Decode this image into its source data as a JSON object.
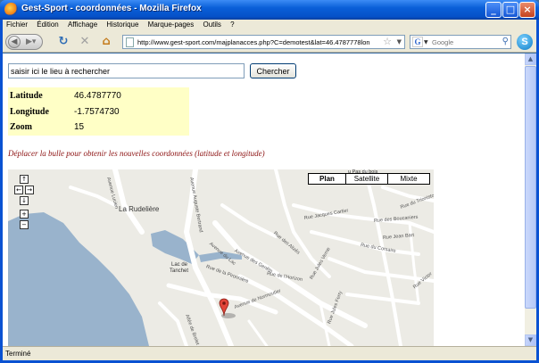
{
  "window": {
    "title": "Gest-Sport - coordonnées - Mozilla Firefox",
    "minimize": "_",
    "maximize": "□",
    "close": "×"
  },
  "menu": [
    "Fichier",
    "Édition",
    "Affichage",
    "Historique",
    "Marque-pages",
    "Outils",
    "?"
  ],
  "nav": {
    "url": "http://www.gest-sport.com/majplanacces.php?C=demotest&lat=46.4787778lon",
    "search_placeholder": "Google",
    "search_logo": "G",
    "skype": "S"
  },
  "page": {
    "search_input_value": "saisir ici le lieu à rechercher",
    "search_button": "Chercher",
    "coords": [
      {
        "label": "Latitude",
        "value": "46.4787770"
      },
      {
        "label": "Longitude",
        "value": "-1.7574730"
      },
      {
        "label": "Zoom",
        "value": "15"
      }
    ],
    "hint": "Déplacer la bulle pour obtenir les nouvelles coordonnées (latitude et longitude)"
  },
  "map": {
    "types": [
      "Plan",
      "Satellite",
      "Mixte"
    ],
    "selected_type": "Plan",
    "places": {
      "rudeliere": "La Rudelière",
      "lac": "Lac de",
      "lac2": "Tanchet",
      "pas_du_bois": "u Pas du bois"
    },
    "streets": [
      "Avenue du Lac",
      "Avenue des Genêts",
      "Rue de la Pironnière",
      "Rue Jacques Cartier",
      "Rue des Boucaniers",
      "Rue Jean Bart",
      "Rue du Trioniston",
      "Rue du Corsaire",
      "Rue de l'Horizon",
      "Avenue de Normoutier",
      "Rue Jules Verne",
      "Rue des Alizés",
      "Allée de Brelet",
      "Rue Jules Ferry",
      "Rue Victor",
      "Avenue Auguste Bertrand",
      "Avenue Lucien"
    ],
    "controls": {
      "up": "↑",
      "left": "←",
      "right": "→",
      "down": "↓",
      "zoom_in": "+",
      "zoom_out": "−"
    }
  },
  "status": "Terminé",
  "colors": {
    "title_bar": "#0a5fd8",
    "coords_bg": "#ffffc6",
    "hint_text": "#8b1010",
    "water": "#99b3cc",
    "marker": "#e2463a"
  }
}
